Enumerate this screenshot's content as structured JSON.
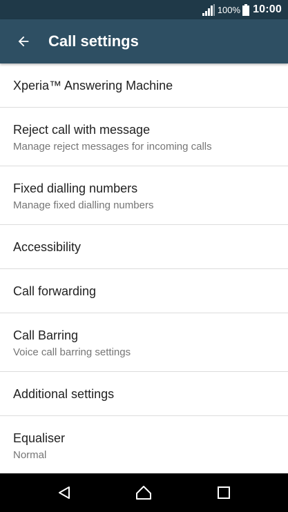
{
  "status_bar": {
    "battery_percent": "100%",
    "time": "10:00",
    "icons": [
      "signal-icon",
      "battery-icon"
    ]
  },
  "app_bar": {
    "title": "Call settings",
    "back_icon": "arrow-back-icon"
  },
  "settings": [
    {
      "title": "Xperia™ Answering Machine",
      "summary": ""
    },
    {
      "title": "Reject call with message",
      "summary": "Manage reject messages for incoming calls"
    },
    {
      "title": "Fixed dialling numbers",
      "summary": "Manage fixed dialling numbers"
    },
    {
      "title": "Accessibility",
      "summary": ""
    },
    {
      "title": "Call forwarding",
      "summary": ""
    },
    {
      "title": "Call Barring",
      "summary": "Voice call barring settings"
    },
    {
      "title": "Additional settings",
      "summary": ""
    },
    {
      "title": "Equaliser",
      "summary": "Normal"
    }
  ],
  "nav_bar": {
    "icons": [
      "back-triangle-icon",
      "home-icon",
      "recents-square-icon"
    ]
  },
  "colors": {
    "status_bar": "#1f3948",
    "app_bar": "#2e4f63",
    "divider": "#dcdcdc",
    "title_text": "#212121",
    "summary_text": "#757575"
  }
}
